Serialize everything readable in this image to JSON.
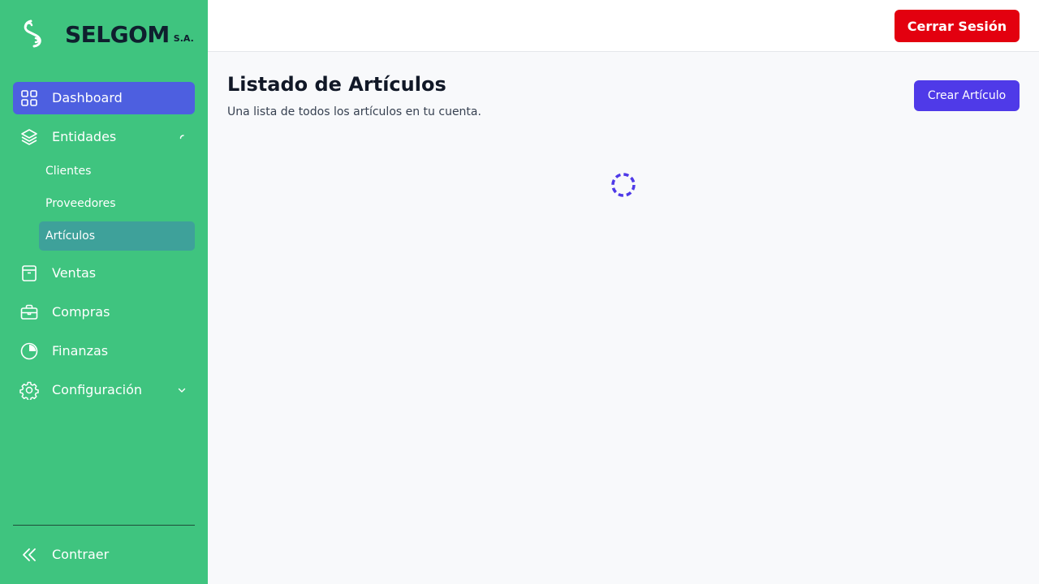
{
  "brand": {
    "name": "SELGOM",
    "suffix": "S.A."
  },
  "sidebar": {
    "items": [
      {
        "label": "Dashboard",
        "icon": "grid-icon"
      },
      {
        "label": "Entidades",
        "icon": "layers-icon"
      },
      {
        "label": "Ventas",
        "icon": "archive-box-icon"
      },
      {
        "label": "Compras",
        "icon": "briefcase-icon"
      },
      {
        "label": "Finanzas",
        "icon": "pie-chart-icon"
      },
      {
        "label": "Configuración",
        "icon": "gear-icon"
      }
    ],
    "subitems": [
      {
        "label": "Clientes"
      },
      {
        "label": "Proveedores"
      },
      {
        "label": "Artículos"
      }
    ],
    "collapse_label": "Contraer"
  },
  "header": {
    "logout_label": "Cerrar Sesión"
  },
  "main": {
    "title": "Listado de Artículos",
    "subtitle": "Una lista de todos los artículos en tu cuenta.",
    "create_label": "Crear Artículo"
  },
  "colors": {
    "sidebar_bg": "#3fc47f",
    "active_item": "#4d5fe0",
    "active_subitem": "#3ea19a",
    "logout_button": "#e3000f",
    "primary_button": "#4f3ae8"
  }
}
